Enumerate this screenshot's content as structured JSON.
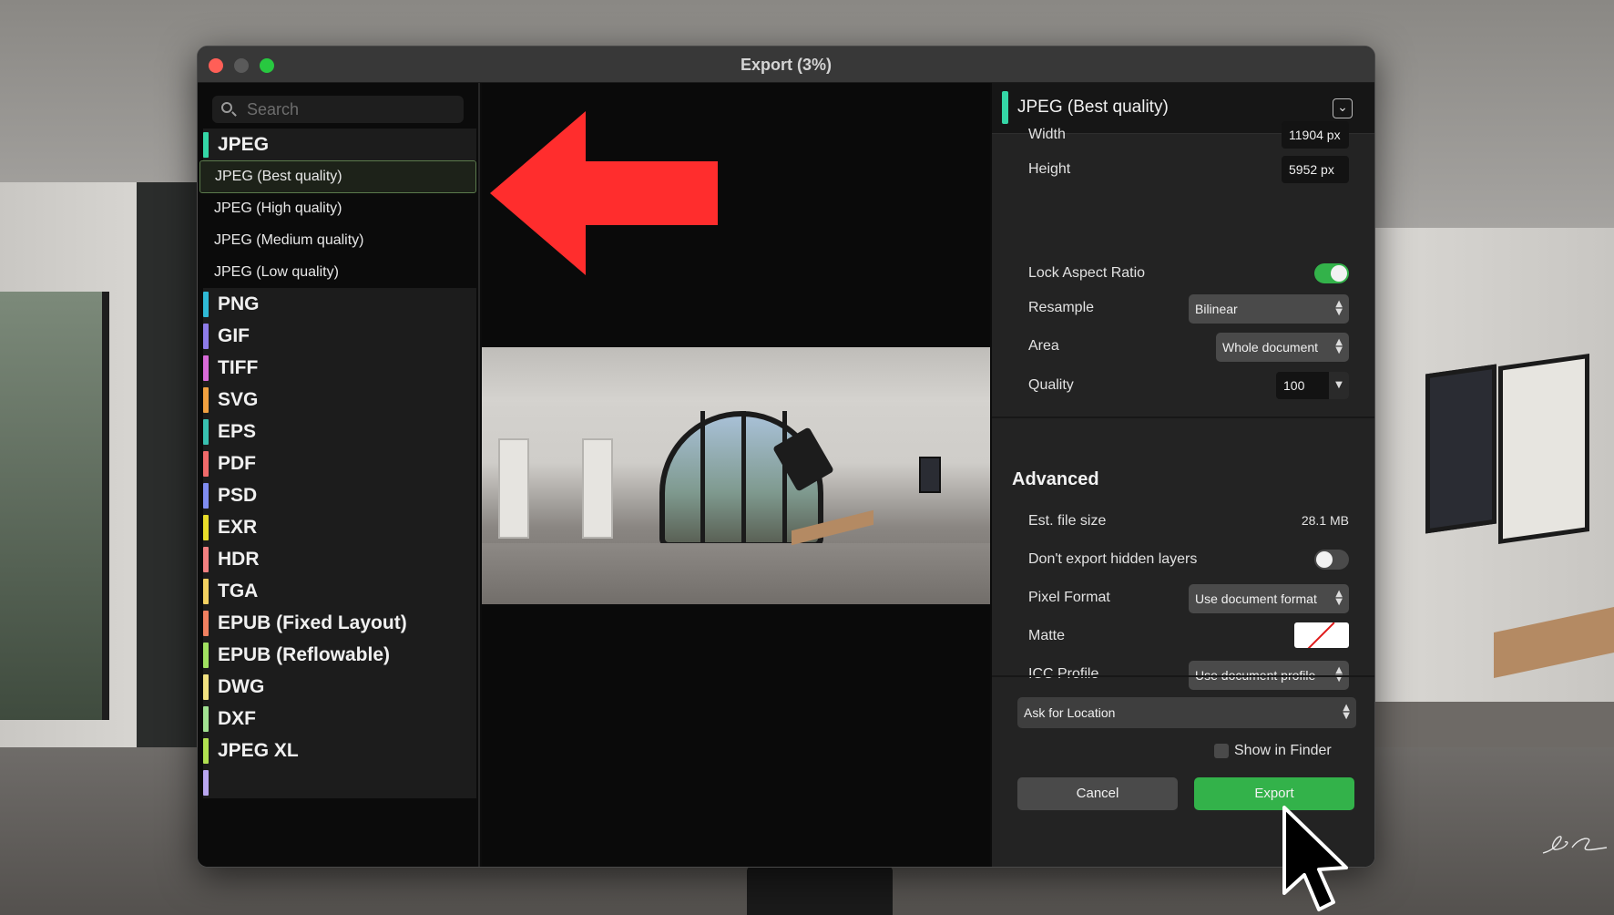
{
  "window": {
    "title": "Export (3%)"
  },
  "search": {
    "placeholder": "Search"
  },
  "formats": {
    "groups": [
      {
        "label": "JPEG",
        "color": "#34d6a6"
      },
      {
        "label": "PNG",
        "color": "#2fb9d6"
      },
      {
        "label": "GIF",
        "color": "#8d7be8"
      },
      {
        "label": "TIFF",
        "color": "#d86ad8"
      },
      {
        "label": "SVG",
        "color": "#f0a040"
      },
      {
        "label": "EPS",
        "color": "#38c0b0"
      },
      {
        "label": "PDF",
        "color": "#f06a6a"
      },
      {
        "label": "PSD",
        "color": "#7f8cf0"
      },
      {
        "label": "EXR",
        "color": "#e8dc2a"
      },
      {
        "label": "HDR",
        "color": "#f28080"
      },
      {
        "label": "TGA",
        "color": "#f2d060"
      },
      {
        "label": "EPUB (Fixed Layout)",
        "color": "#f08060"
      },
      {
        "label": "EPUB (Reflowable)",
        "color": "#a0e060"
      },
      {
        "label": "DWG",
        "color": "#f0e080"
      },
      {
        "label": "DXF",
        "color": "#a0e090"
      },
      {
        "label": "JPEG XL",
        "color": "#b0e050"
      }
    ],
    "jpeg_presets": [
      "JPEG (Best quality)",
      "JPEG (High quality)",
      "JPEG (Medium quality)",
      "JPEG (Low quality)"
    ],
    "selected": "JPEG (Best quality)"
  },
  "panel": {
    "title": "JPEG (Best quality)",
    "width_label": "Width",
    "width_value": "11904 px",
    "height_label": "Height",
    "height_value": "5952 px",
    "lock_label": "Lock Aspect Ratio",
    "lock_on": true,
    "resample_label": "Resample",
    "resample_value": "Bilinear",
    "area_label": "Area",
    "area_value": "Whole document",
    "quality_label": "Quality",
    "quality_value": "100",
    "advanced_heading": "Advanced",
    "filesize_label": "Est. file size",
    "filesize_value": "28.1 MB",
    "hidden_label": "Don't export hidden layers",
    "hidden_on": false,
    "pixel_label": "Pixel Format",
    "pixel_value": "Use document format",
    "matte_label": "Matte",
    "icc_label": "ICC Profile",
    "icc_value": "Use document profile",
    "location_value": "Ask for Location",
    "finder_label": "Show in Finder",
    "finder_checked": false,
    "cancel_label": "Cancel",
    "export_label": "Export"
  },
  "overlay": {
    "signature": "BC"
  },
  "colors": {
    "accent": "#33b24a",
    "arrow": "#ff2d2d",
    "selection_border": "#5b7a4c"
  }
}
